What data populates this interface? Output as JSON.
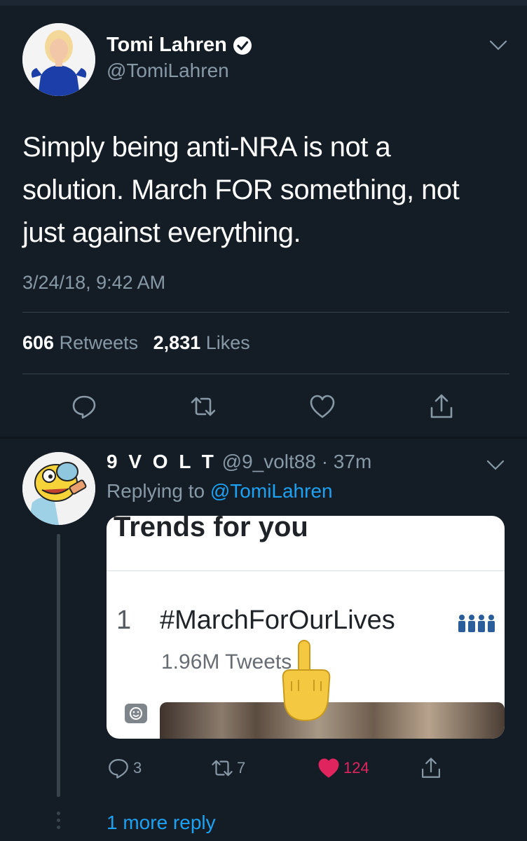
{
  "tweet": {
    "author_name": "Tomi Lahren",
    "author_handle": "@TomiLahren",
    "text_lines": [
      "Simply being anti-NRA is not a",
      "solution. March FOR something, not",
      "just against everything."
    ],
    "timestamp": "3/24/18, 9:42 AM",
    "retweet_count": "606",
    "retweet_label": "Retweets",
    "like_count": "2,831",
    "like_label": "Likes"
  },
  "reply": {
    "author_name": "9 V O L T",
    "author_handle_meta": "@9_volt88 · 37m",
    "replying_prefix": "Replying to",
    "replying_to": "@TomiLahren",
    "embed": {
      "title": "Trends for you",
      "rank": "1",
      "hashtag": "#MarchForOurLives",
      "tweet_count": "1.96M Tweets"
    },
    "reply_count": "3",
    "retweet_count": "7",
    "like_count": "124",
    "more_replies": "1 more reply"
  },
  "colors": {
    "background": "#141d26",
    "muted": "#8899a6",
    "link": "#1da1f2",
    "liked": "#e0245e"
  },
  "icons": [
    "verified-icon",
    "caret-down-icon",
    "reply-icon",
    "retweet-icon",
    "like-icon",
    "share-icon",
    "smiley-icon"
  ]
}
